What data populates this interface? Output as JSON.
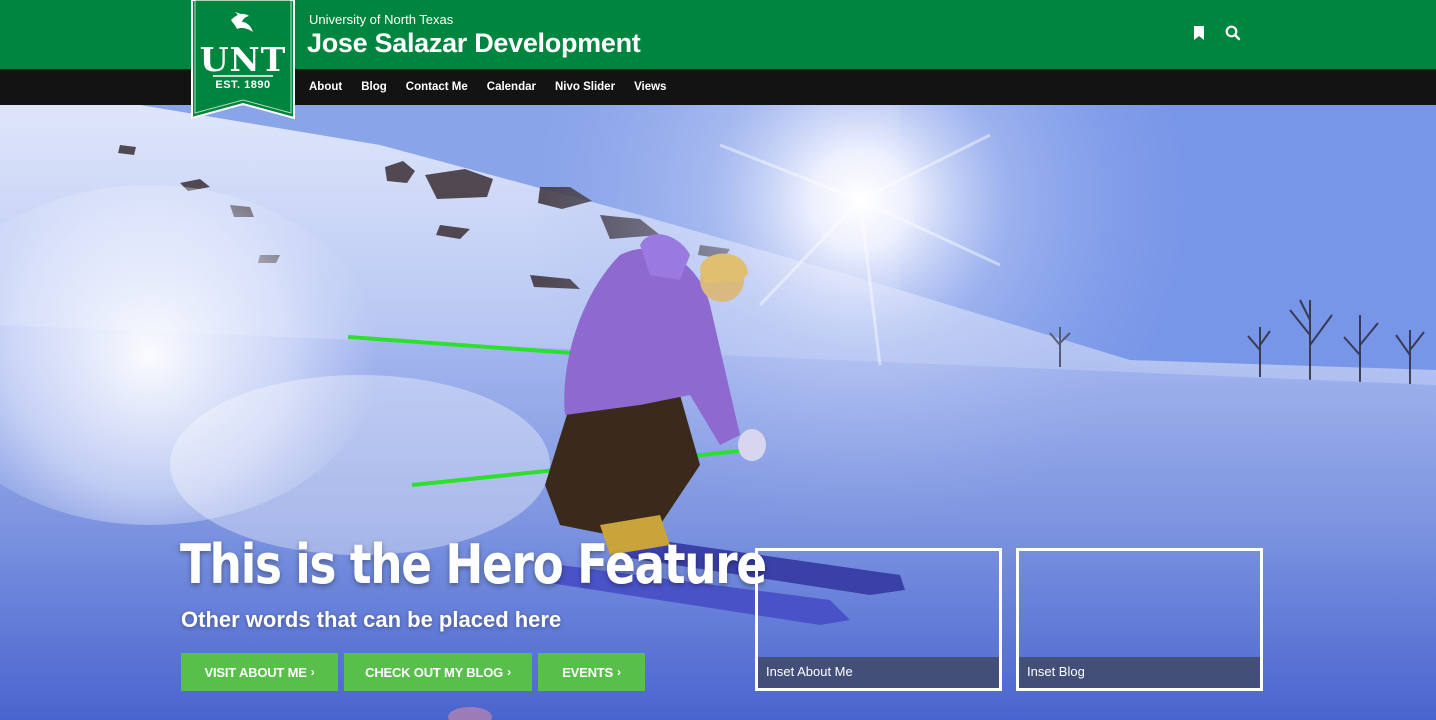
{
  "header": {
    "university": "University of North Texas",
    "site_title": "Jose Salazar Development",
    "logo": {
      "text": "UNT",
      "established": "EST. 1890"
    },
    "icons": [
      "bookmark-icon",
      "search-icon"
    ]
  },
  "nav": {
    "items": [
      "About",
      "Blog",
      "Contact Me",
      "Calendar",
      "Nivo Slider",
      "Views"
    ]
  },
  "hero": {
    "title": "This is the Hero Feature",
    "subtitle": "Other words that can be placed here",
    "buttons": [
      {
        "label": "VISIT ABOUT ME",
        "icon": "chevron-right-icon"
      },
      {
        "label": "CHECK OUT MY BLOG",
        "icon": "chevron-right-icon"
      },
      {
        "label": "EVENTS",
        "icon": "chevron-right-icon"
      }
    ],
    "insets": [
      "Inset About Me",
      "Inset Blog"
    ]
  },
  "colors": {
    "brand_green": "#00853e",
    "nav_black": "#131313",
    "button_green": "#58c04a"
  }
}
